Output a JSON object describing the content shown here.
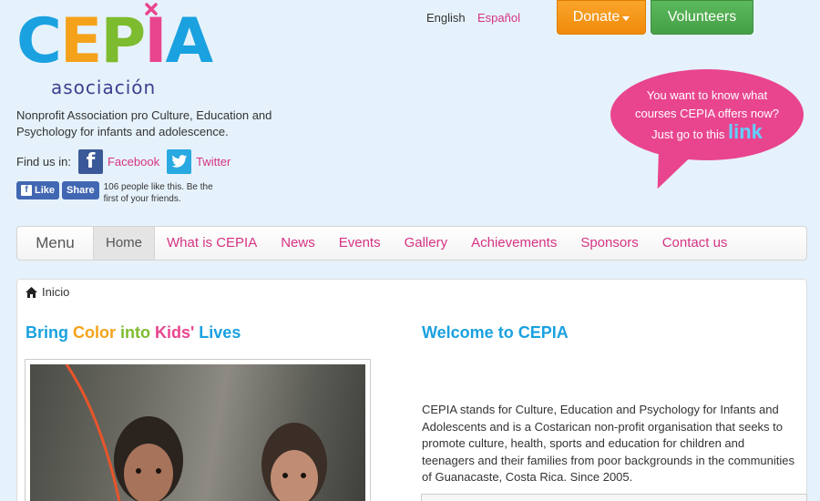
{
  "logo": {
    "letters": [
      {
        "char": "C",
        "color": "#1aa1e0"
      },
      {
        "char": "E",
        "color": "#f5a21b"
      },
      {
        "char": "P",
        "color": "#7dbb2f"
      },
      {
        "char": "I",
        "color": "#e9458f"
      },
      {
        "char": "A",
        "color": "#1aa1e0"
      }
    ],
    "sub": "asociación"
  },
  "tagline": "Nonprofit Association pro Culture, Education and Psychology for infants and adolescence.",
  "findus": {
    "label": "Find us in:",
    "facebook": "Facebook",
    "twitter": "Twitter"
  },
  "fb": {
    "like": "Like",
    "share": "Share",
    "count_text": "106 people like this. Be the first of your friends."
  },
  "lang": {
    "en": "English",
    "es": "Español"
  },
  "buttons": {
    "donate": "Donate",
    "volunteers": "Volunteers"
  },
  "bubble": {
    "line1": "You want to know what",
    "line2": "courses CEPIA offers now?",
    "line3": "Just go to this",
    "link": "link"
  },
  "nav": {
    "menu": "Menu",
    "items": [
      "Home",
      "What is CEPIA",
      "News",
      "Events",
      "Gallery",
      "Achievements",
      "Sponsors",
      "Contact us"
    ]
  },
  "breadcrumb": "Inicio",
  "headline_left": [
    {
      "text": "Bring ",
      "color": "#1aa1e0"
    },
    {
      "text": "Color",
      "color": "#f5a21b"
    },
    {
      "text": " into ",
      "color": "#7dbb2f"
    },
    {
      "text": "Kids'",
      "color": "#e9458f"
    },
    {
      "text": " Lives",
      "color": "#1aa1e0"
    }
  ],
  "headline_right": "Welcome to CEPIA",
  "paragraph": "CEPIA stands for Culture, Education and Psychology for Infants and Adolescents and is a Costarican non-profit organisation that seeks to promote culture, health, sports and education for children and teenagers and their families from poor backgrounds in the communities of Guanacaste, Costa Rica. Since 2005."
}
